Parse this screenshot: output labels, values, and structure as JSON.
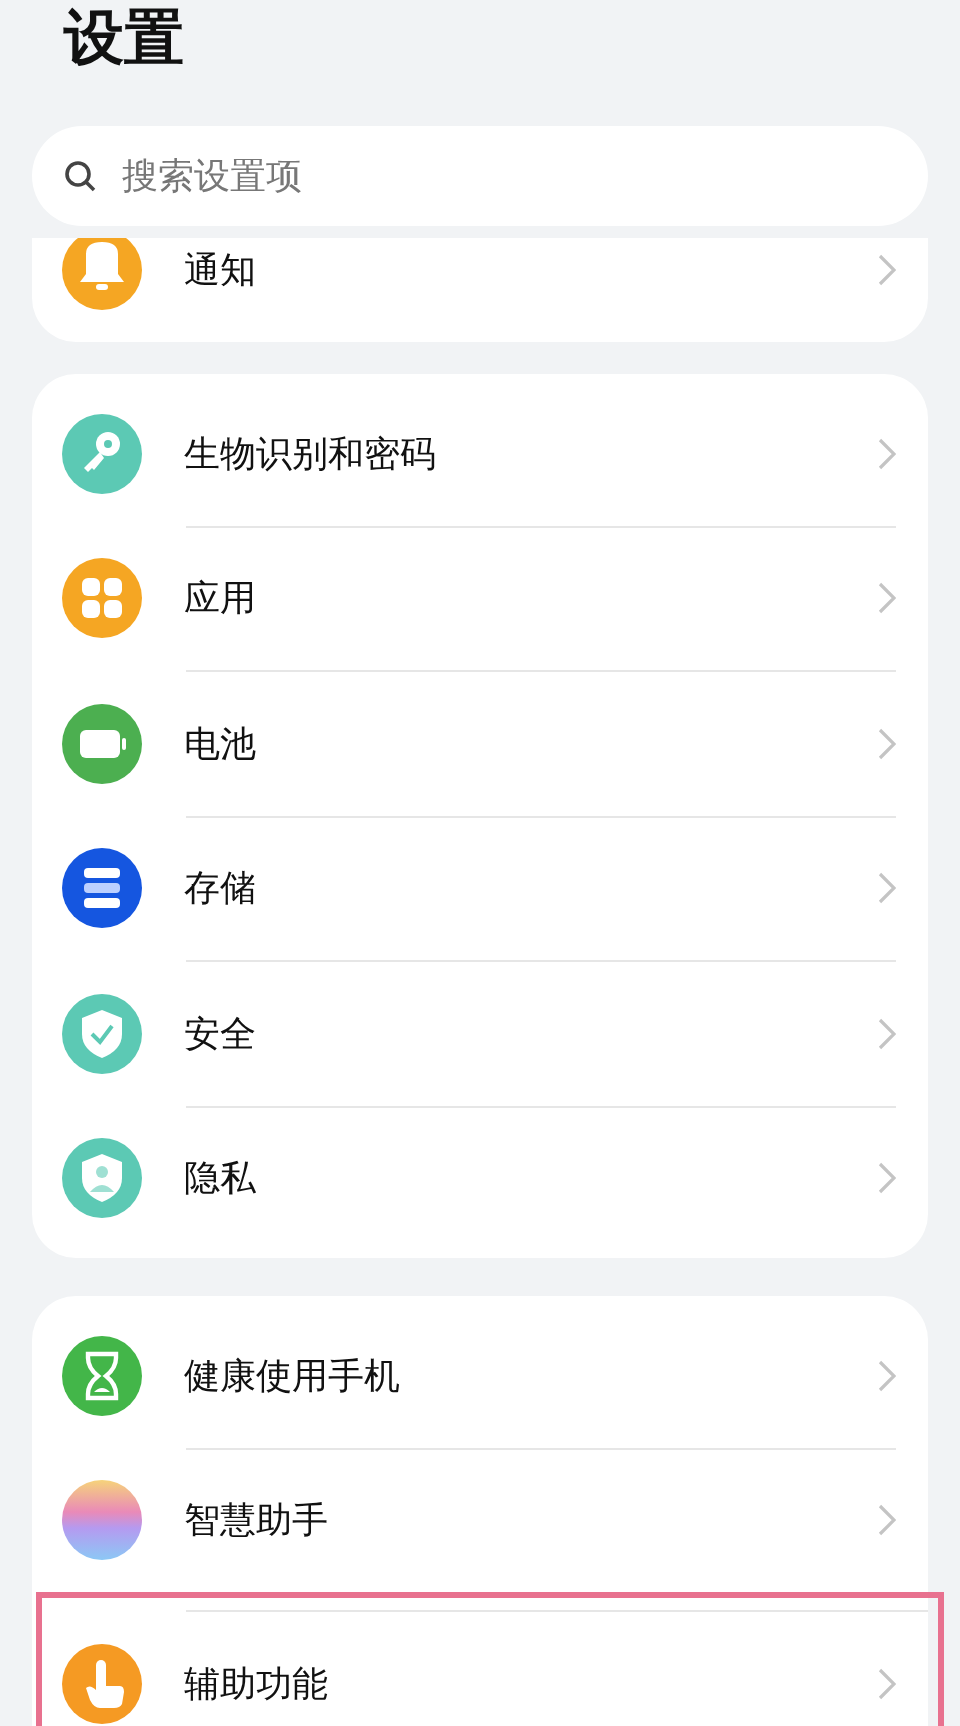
{
  "title": "设置",
  "search": {
    "placeholder": "搜索设置项"
  },
  "groups": [
    {
      "clipped": true,
      "items": [
        {
          "label": "通知",
          "kind": "bell",
          "highlighted": false
        }
      ]
    },
    {
      "clipped": false,
      "items": [
        {
          "label": "生物识别和密码",
          "kind": "key",
          "highlighted": false
        },
        {
          "label": "应用",
          "kind": "apps",
          "highlighted": false
        },
        {
          "label": "电池",
          "kind": "battery",
          "highlighted": false
        },
        {
          "label": "存储",
          "kind": "storage",
          "highlighted": false
        },
        {
          "label": "安全",
          "kind": "shield",
          "highlighted": false
        },
        {
          "label": "隐私",
          "kind": "privacy",
          "highlighted": false
        }
      ]
    },
    {
      "clipped": false,
      "items": [
        {
          "label": "健康使用手机",
          "kind": "hourglass",
          "highlighted": false
        },
        {
          "label": "智慧助手",
          "kind": "orb",
          "highlighted": false
        },
        {
          "label": "辅助功能",
          "kind": "hand",
          "highlighted": true
        }
      ]
    }
  ]
}
